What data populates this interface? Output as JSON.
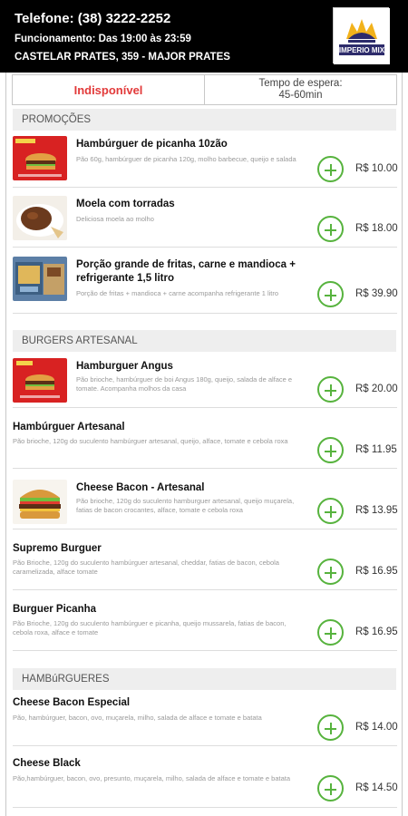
{
  "header": {
    "phone": "Telefone: (38) 3222-2252",
    "hours": "Funcionamento: Das 19:00 às 23:59",
    "address": "CASTELAR PRATES, 359 - MAJOR PRATES",
    "logo_text": "IMPERIO MIX"
  },
  "status": {
    "availability": "Indisponível",
    "wait_label": "Tempo de espera:",
    "wait_value": "45-60min"
  },
  "sections": [
    {
      "title": "PROMOÇÕES",
      "items": [
        {
          "name": "Hambúrguer de picanha 10zão",
          "description": "Pão 60g, hambúrguer de picanha 120g, molho barbecue, queijo e salada",
          "price": "R$ 10.00",
          "image": "burger-promo-image"
        },
        {
          "name": "Moela com torradas",
          "description": "Deliciosa moela ao molho",
          "price": "R$ 18.00",
          "image": "moela-image"
        },
        {
          "name": "Porção grande de fritas, carne e mandioca + refrigerante 1,5 litro",
          "description": "Porção de fritas + mandioca + carne acompanha refrigerante 1 litro",
          "price": "R$ 39.90",
          "image": "fries-combo-image"
        }
      ]
    },
    {
      "title": "BURGERS ARTESANAL",
      "items": [
        {
          "name": "Hamburguer Angus",
          "description": "Pão brioche, hambúrguer de boi Angus 180g, queijo, salada de alface e tomate. Acompanha molhos da casa",
          "price": "R$ 20.00",
          "image": "angus-image"
        },
        {
          "name": "Hambúrguer Artesanal",
          "description": "Pão brioche, 120g do suculento hambúrguer artesanal, queijo, alface, tomate e cebola roxa",
          "price": "R$ 11.95"
        },
        {
          "name": "Cheese Bacon - Artesanal",
          "description": "Pão brioche, 120g do suculento hamburguer artesanal, queijo muçarela, fatias de bacon crocantes, alface, tomate e cebola roxa",
          "price": "R$ 13.95",
          "image": "cheese-bacon-image"
        },
        {
          "name": "Supremo Burguer",
          "description": "Pão Brioche, 120g do suculento hambúrguer artesanal, cheddar, fatias de bacon, cebola caramelizada, alface tomate",
          "price": "R$ 16.95"
        },
        {
          "name": "Burguer Picanha",
          "description": "Pão Brioche, 120g do suculento hambúrguer e picanha, queijo mussarela, fatias de bacon, cebola roxa, alface e tomate",
          "price": "R$ 16.95"
        }
      ]
    },
    {
      "title": "HAMBúRGUERES",
      "items": [
        {
          "name": "Cheese Bacon Especial",
          "description": "Pão, hambúrguer, bacon, ovo, muçarela, milho, salada de alface e tomate e batata",
          "price": "R$ 14.00"
        },
        {
          "name": "Cheese Black",
          "description": "Pão,hambúrguer, bacon, ovo, presunto, muçarela, milho, salada de alface e tomate e batata",
          "price": "R$ 14.50"
        }
      ]
    }
  ],
  "colors": {
    "header_bg": "#000000",
    "unavailable": "#e23a3a",
    "add_button": "#57b33e",
    "section_bg": "#eeeeee"
  }
}
